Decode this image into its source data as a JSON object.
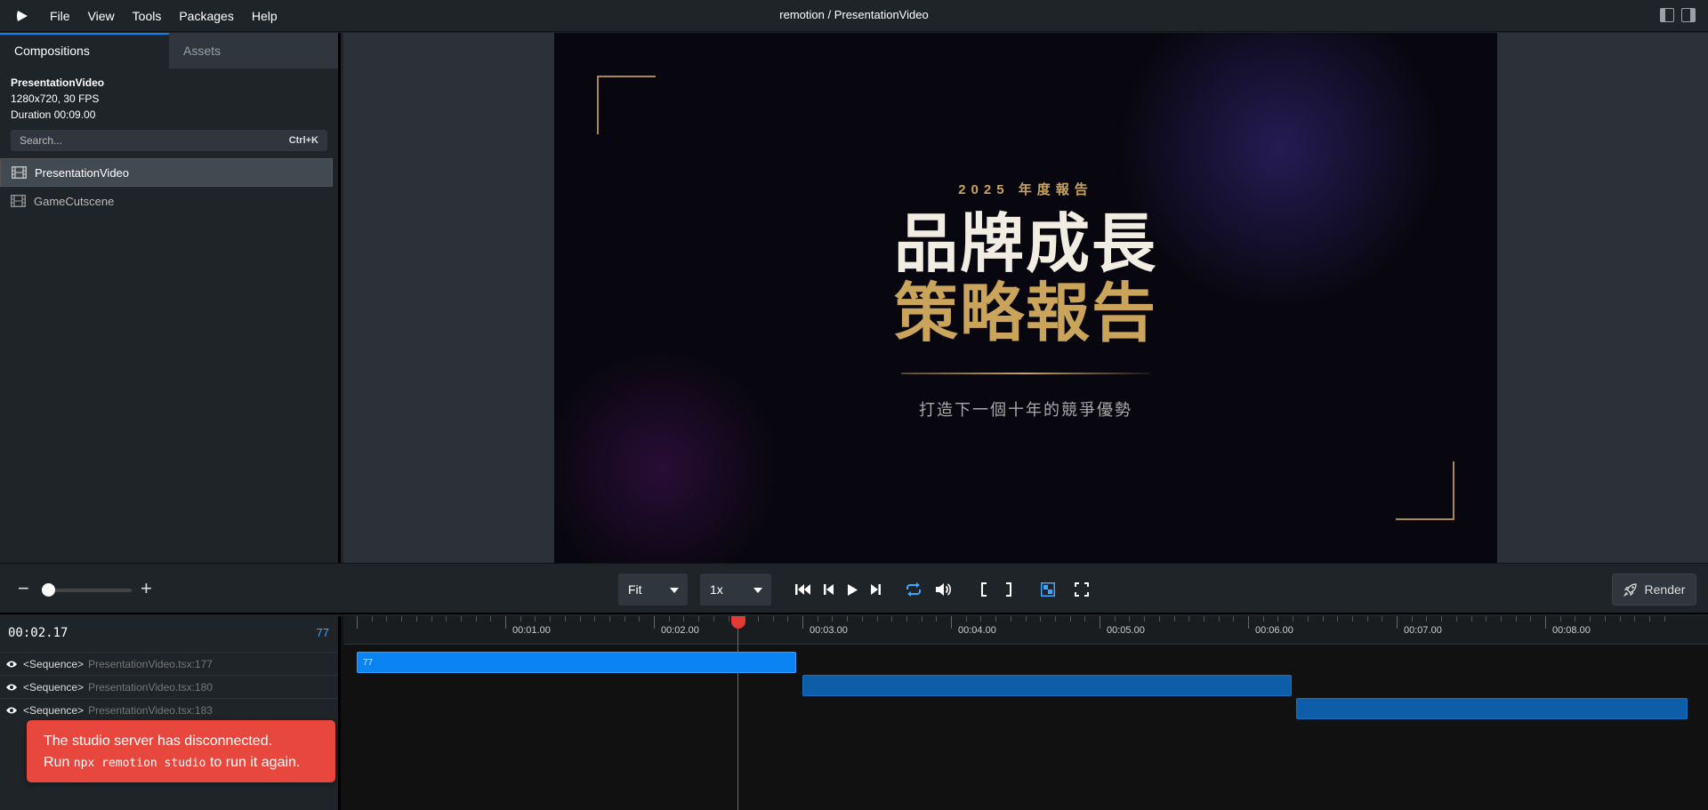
{
  "app": {
    "title": "remotion / PresentationVideo",
    "menu": [
      "File",
      "View",
      "Tools",
      "Packages",
      "Help"
    ]
  },
  "sidebar": {
    "tabs": [
      "Compositions",
      "Assets"
    ],
    "composition": {
      "name": "PresentationVideo",
      "meta": "1280x720, 30 FPS",
      "duration": "Duration 00:09.00"
    },
    "search": {
      "placeholder": "Search...",
      "shortcut": "Ctrl+K"
    },
    "items": [
      "PresentationVideo",
      "GameCutscene"
    ]
  },
  "canvas": {
    "kicker": "2025 年度報告",
    "title_line1": "品牌成長",
    "title_line2": "策略報告",
    "subtitle": "打造下一個十年的競爭優勢",
    "colors": {
      "gold": "#c9a45a",
      "cream": "#f2ede3",
      "background": "#08070f"
    }
  },
  "controls": {
    "zoom_level": 0.0,
    "fit": "Fit",
    "speed": "1x",
    "render": "Render"
  },
  "timeline": {
    "timecode": "00:02.17",
    "frame": "77",
    "ruler_labels": [
      "00:01.00",
      "00:02.00",
      "00:03.00",
      "00:04.00",
      "00:05.00",
      "00:06.00",
      "00:07.00",
      "00:08.00"
    ],
    "tracks": [
      {
        "label": "<Sequence>",
        "file": "PresentationVideo.tsx:177",
        "bar_label": "77"
      },
      {
        "label": "<Sequence>",
        "file": "PresentationVideo.tsx:180",
        "bar_label": ""
      },
      {
        "label": "<Sequence>",
        "file": "PresentationVideo.tsx:183",
        "bar_label": ""
      }
    ]
  },
  "toast": {
    "line1": "The studio server has disconnected.",
    "line2_pre": "Run ",
    "line2_code": "npx remotion studio",
    "line2_post": " to run it again."
  }
}
